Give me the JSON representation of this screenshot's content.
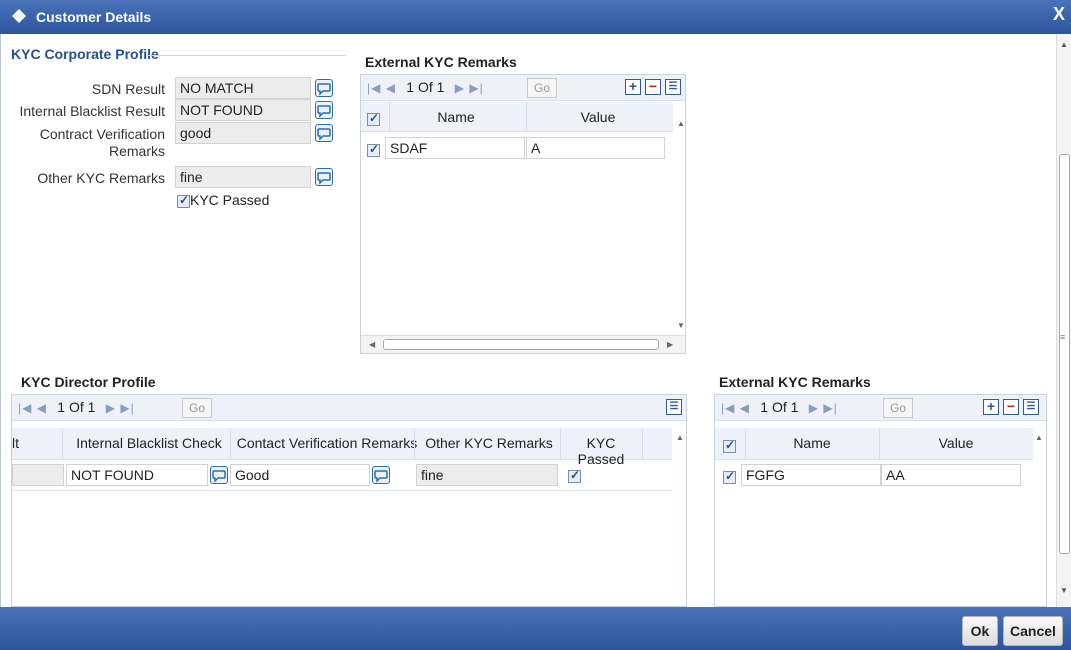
{
  "window": {
    "title": "Customer Details",
    "close_label": "X"
  },
  "corporate": {
    "legend": "KYC Corporate Profile",
    "fields": [
      {
        "label": "SDN Result",
        "value": "NO MATCH"
      },
      {
        "label": "Internal Blacklist Result",
        "value": "NOT FOUND"
      },
      {
        "label": "Contract Verification",
        "label2": "Remarks",
        "value": "good"
      },
      {
        "label": "Other KYC Remarks",
        "value": "fine"
      }
    ],
    "kyc_passed_label": "KYC Passed"
  },
  "ext_remarks_top": {
    "title": "External KYC Remarks",
    "pager": {
      "text": "1 Of 1",
      "go": "Go"
    },
    "columns": [
      "Name",
      "Value"
    ],
    "rows": [
      {
        "name": "SDAF",
        "value": "A"
      }
    ]
  },
  "director": {
    "title": "KYC Director Profile",
    "pager": {
      "text": "1 Of 1",
      "go": "Go"
    },
    "columns": [
      "lt",
      "Internal Blacklist Check",
      "Contact Verification Remarks",
      "Other KYC Remarks",
      "KYC Passed"
    ],
    "rows": [
      {
        "internal_blacklist": "NOT FOUND",
        "contact_verification": "Good",
        "other_kyc": "fine"
      }
    ]
  },
  "ext_remarks_bottom": {
    "title": "External KYC Remarks",
    "pager": {
      "text": "1 Of 1",
      "go": "Go"
    },
    "columns": [
      "Name",
      "Value"
    ],
    "rows": [
      {
        "name": "FGFG",
        "value": "AA"
      }
    ]
  },
  "footer": {
    "ok_label": "Ok",
    "cancel_label": "Cancel"
  },
  "icons": {
    "logo": "diamond-icon",
    "lookup": "speech-bubble-icon",
    "add": "plus-icon",
    "delete": "minus-icon",
    "view": "list-icon"
  },
  "colors": {
    "titlebar": "#2d559e",
    "accent": "#2a4f8f"
  }
}
